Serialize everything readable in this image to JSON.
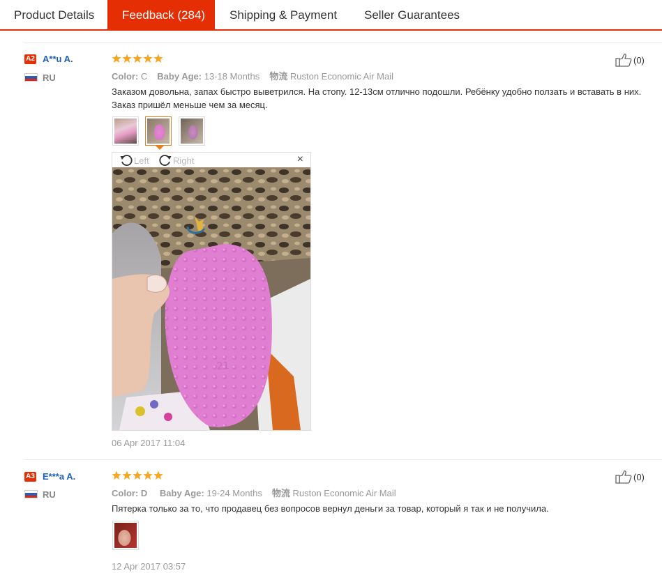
{
  "tabs": [
    {
      "label": "Product Details"
    },
    {
      "label": "Feedback (284)"
    },
    {
      "label": "Shipping & Payment"
    },
    {
      "label": "Seller Guarantees"
    }
  ],
  "labels": {
    "color": "Color:",
    "baby_age": "Baby Age:",
    "logistics": "物流"
  },
  "viewer": {
    "rotate_left": "Left",
    "rotate_right": "Right",
    "close": "×"
  },
  "reviews": [
    {
      "level": "A2",
      "name": "A**u A.",
      "country": "RU",
      "rating": 5,
      "color": "C",
      "baby_age": "13-18 Months",
      "shipping": "Ruston Economic Air Mail",
      "text": "Заказом довольна, запах быстро выветрился. На стопу. 12-13см отлично подошли. Ребёнку удобно ползать и вставать в них. Заказ пришёл меньше чем за месяц.",
      "likes": "(0)",
      "date": "06 Apr 2017 11:04"
    },
    {
      "level": "A3",
      "name": "E***a A.",
      "country": "RU",
      "rating": 5,
      "baby_age": "19-24 Months",
      "shipping": "Ruston Economic Air Mail",
      "text": "Пятерка только за то, что продавец без вопросов вернул деньги за товар, который я так и не получила.",
      "likes": "(0)",
      "date": "12 Apr 2017 03:57"
    }
  ],
  "colors": {
    "accent": "#e62e04",
    "link": "#1e60b8",
    "star": "#f5a623",
    "muted": "#999999"
  }
}
